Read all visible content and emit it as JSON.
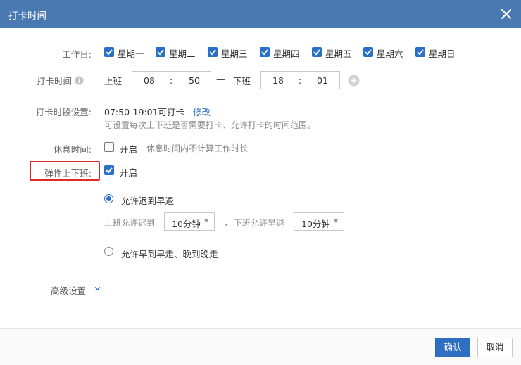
{
  "dialog": {
    "title": "打卡时间"
  },
  "workdays": {
    "label": "工作日:",
    "days": [
      "星期一",
      "星期二",
      "星期三",
      "星期四",
      "星期五",
      "星期六",
      "星期日"
    ]
  },
  "clock_time": {
    "label": "打卡时间",
    "on_label": "上班",
    "on_hour": "08",
    "on_minute": "50",
    "dash": "—",
    "off_label": "下班",
    "off_hour": "18",
    "off_minute": "01",
    "colon": ":"
  },
  "period": {
    "label": "打卡时段设置:",
    "value": "07:50-19:01可打卡",
    "edit_link": "修改",
    "hint": "可设置每次上下班是否需要打卡、允许打卡的时间范围。"
  },
  "rest": {
    "label": "休息时间:",
    "checkbox_label": "开启",
    "hint": "休息时间内不计算工作时长"
  },
  "flex": {
    "label": "弹性上下班:",
    "checkbox_label": "开启",
    "option1": "允许迟到早退",
    "late_label": "上班允许迟到",
    "late_value": "10分钟",
    "separator": "，",
    "early_label": "下班允许早退",
    "early_value": "10分钟",
    "option2": "允许早到早走、晚到晚走"
  },
  "advanced": {
    "label": "高级设置"
  },
  "footer": {
    "confirm": "确认",
    "cancel": "取消"
  },
  "colors": {
    "titlebar": "#4a79b1",
    "accent": "#2a6fc9",
    "highlight": "#e02b2b"
  }
}
